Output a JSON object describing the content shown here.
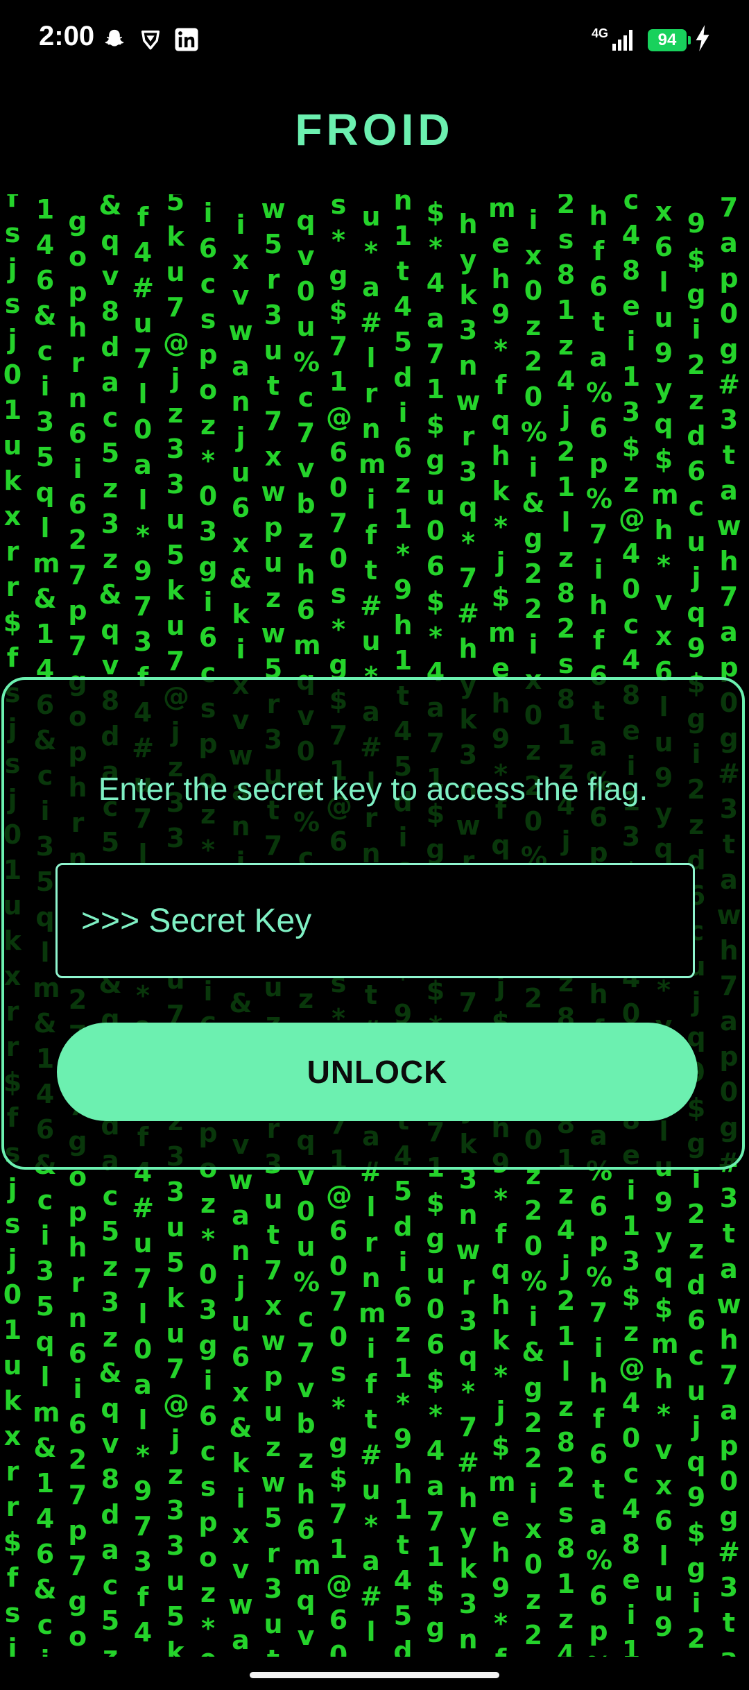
{
  "status_bar": {
    "time": "2:00",
    "network": "4G",
    "battery_level": "94",
    "notification_icons": [
      "snapchat-icon",
      "brave-icon",
      "linkedin-icon"
    ],
    "right_icons": [
      "signal-icon",
      "battery-icon",
      "charging-icon"
    ]
  },
  "app": {
    "title": "FROID"
  },
  "card": {
    "prompt": "Enter the secret key to access the flag.",
    "input_value": "",
    "input_placeholder": ">>> Secret Key",
    "button_label": "UNLOCK"
  },
  "matrix_rain": {
    "color": "#25d32b",
    "columns": [
      "fsjsj01ukxrr$",
      "lm&146&ci35q",
      "i627p7gophrn6",
      "v8dac5z3z&q",
      "4#u7l0al*973f",
      "jz33u5ku7@",
      "poz*03gi6cs",
      "wanju6x&kixv",
      "w5r3ut7xwpuz",
      "mqv0u%c7vbzh6",
      "$71@6070s*g",
      "#lrnmift#u*a",
      "h1t45di6z1*9",
      "1$gu06$*4a7",
      "r3q*7#hyk3nw",
      "9*fqhk*j$meh",
      "ix0z20%i&g22",
      "lz82s81z4j21",
      "f6ta%6p%7ih",
      "ei13$z@40c48",
      "x6lu9yq$mh*v",
      "ujq9$gi2zd6c",
      "7ap0g#3tawh"
    ]
  },
  "colors": {
    "accent": "#6cf0b0",
    "background": "#000000",
    "matrix": "#25d32b"
  }
}
